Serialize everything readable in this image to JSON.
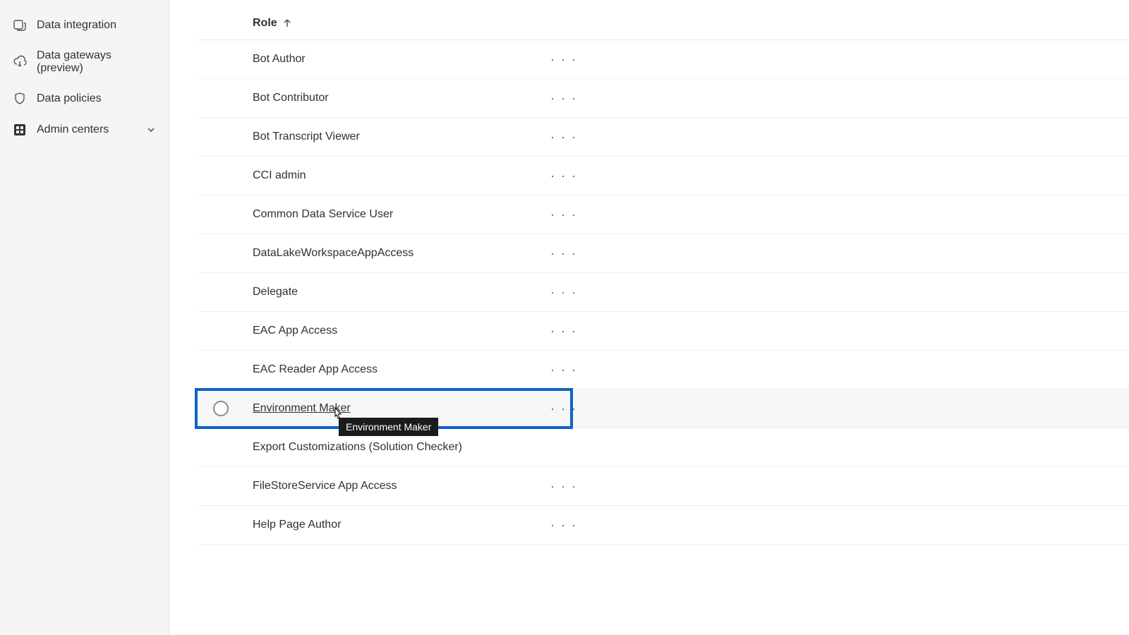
{
  "sidebar": {
    "items": [
      {
        "label": "Data integration",
        "icon": "data-integration-icon"
      },
      {
        "label": "Data gateways (preview)",
        "icon": "cloud-download-icon"
      },
      {
        "label": "Data policies",
        "icon": "shield-icon"
      },
      {
        "label": "Admin centers",
        "icon": "admin-centers-icon",
        "expandable": true
      }
    ]
  },
  "table": {
    "header": {
      "role": "Role"
    },
    "rows": [
      {
        "name": "Bot Author"
      },
      {
        "name": "Bot Contributor"
      },
      {
        "name": "Bot Transcript Viewer"
      },
      {
        "name": "CCI admin"
      },
      {
        "name": "Common Data Service User"
      },
      {
        "name": "DataLakeWorkspaceAppAccess"
      },
      {
        "name": "Delegate"
      },
      {
        "name": "EAC App Access"
      },
      {
        "name": "EAC Reader App Access"
      },
      {
        "name": "Environment Maker",
        "highlighted": true,
        "tooltip": "Environment Maker"
      },
      {
        "name": "Export Customizations (Solution Checker)"
      },
      {
        "name": "FileStoreService App Access"
      },
      {
        "name": "Help Page Author"
      }
    ],
    "more_glyph": "· · ·"
  }
}
